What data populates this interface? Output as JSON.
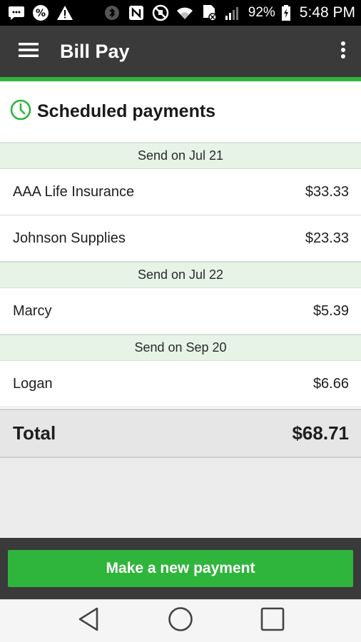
{
  "status_bar": {
    "left_icons": [
      "message-icon",
      "percent-badge-icon",
      "warning-icon"
    ],
    "right_icons": [
      "bluetooth-icon",
      "nfc-icon",
      "mute-icon",
      "wifi-icon",
      "sim-icon",
      "signal-icon"
    ],
    "battery_percent": "92%",
    "time": "5:48 PM"
  },
  "app_bar": {
    "title": "Bill Pay",
    "menu_icon": "hamburger-menu-icon",
    "overflow_icon": "more-vert-icon"
  },
  "section": {
    "title": "Scheduled payments",
    "icon": "clock-icon"
  },
  "groups": [
    {
      "header": "Send on Jul 21",
      "items": [
        {
          "payee": "AAA Life Insurance",
          "amount": "$33.33"
        },
        {
          "payee": "Johnson Supplies",
          "amount": "$23.33"
        }
      ]
    },
    {
      "header": "Send on Jul 22",
      "items": [
        {
          "payee": "Marcy",
          "amount": "$5.39"
        }
      ]
    },
    {
      "header": "Send on Sep 20",
      "items": [
        {
          "payee": "Logan",
          "amount": "$6.66"
        }
      ]
    }
  ],
  "total": {
    "label": "Total",
    "amount": "$68.71"
  },
  "primary_action": "Make a new payment",
  "colors": {
    "accent": "#2fb53f",
    "app_bar": "#3a3a3a",
    "group_header_bg": "#e6f3e6"
  }
}
